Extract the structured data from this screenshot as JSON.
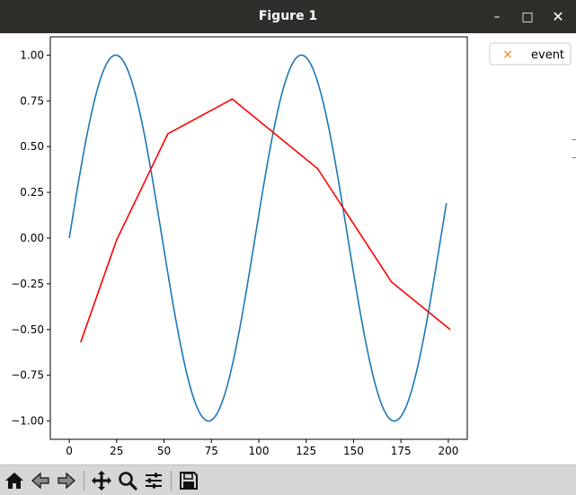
{
  "window": {
    "title": "Figure 1",
    "buttons": [
      "minimize",
      "maximize",
      "close"
    ]
  },
  "toolbar": {
    "tools": [
      {
        "name": "home-icon",
        "tip": "Reset original view"
      },
      {
        "name": "back-icon",
        "tip": "Back to previous view"
      },
      {
        "name": "forward-icon",
        "tip": "Forward to next view"
      },
      {
        "name": "pan-icon",
        "tip": "Pan axes"
      },
      {
        "name": "zoom-icon",
        "tip": "Zoom to rectangle"
      },
      {
        "name": "configure-subplots-icon",
        "tip": "Configure subplots"
      },
      {
        "name": "save-icon",
        "tip": "Save the figure"
      }
    ]
  },
  "chart_data": {
    "type": "line",
    "title": "",
    "xlabel": "",
    "ylabel": "",
    "xlim": [
      -10,
      210
    ],
    "ylim": [
      -1.1,
      1.1
    ],
    "xticks": [
      0,
      25,
      50,
      75,
      100,
      125,
      150,
      175,
      200
    ],
    "xtick_labels": [
      "0",
      "25",
      "50",
      "75",
      "100",
      "125",
      "150",
      "175",
      "200"
    ],
    "yticks": [
      1.0,
      0.75,
      0.5,
      0.25,
      0.0,
      -0.25,
      -0.5,
      -0.75,
      -1.0
    ],
    "ytick_labels": [
      "1.00",
      "0.75",
      "0.50",
      "0.25",
      "0.00",
      "−0.25",
      "−0.50",
      "−0.75",
      "−1.00"
    ],
    "grid": false,
    "legend": {
      "placement": "outside-top-right",
      "entries": [
        {
          "label": "event",
          "marker": "x",
          "color": "#ff7f0e"
        }
      ]
    },
    "series": [
      {
        "style": "sine",
        "color": "#1f77b4",
        "x_start": 0,
        "x_end": 199,
        "period": 98,
        "amplitude": 1.0
      },
      {
        "color": "#ff0000",
        "x": [
          6,
          25,
          52,
          86,
          131,
          170,
          201
        ],
        "y": [
          -0.57,
          -0.01,
          0.57,
          0.76,
          0.38,
          -0.24,
          -0.5
        ]
      }
    ]
  }
}
